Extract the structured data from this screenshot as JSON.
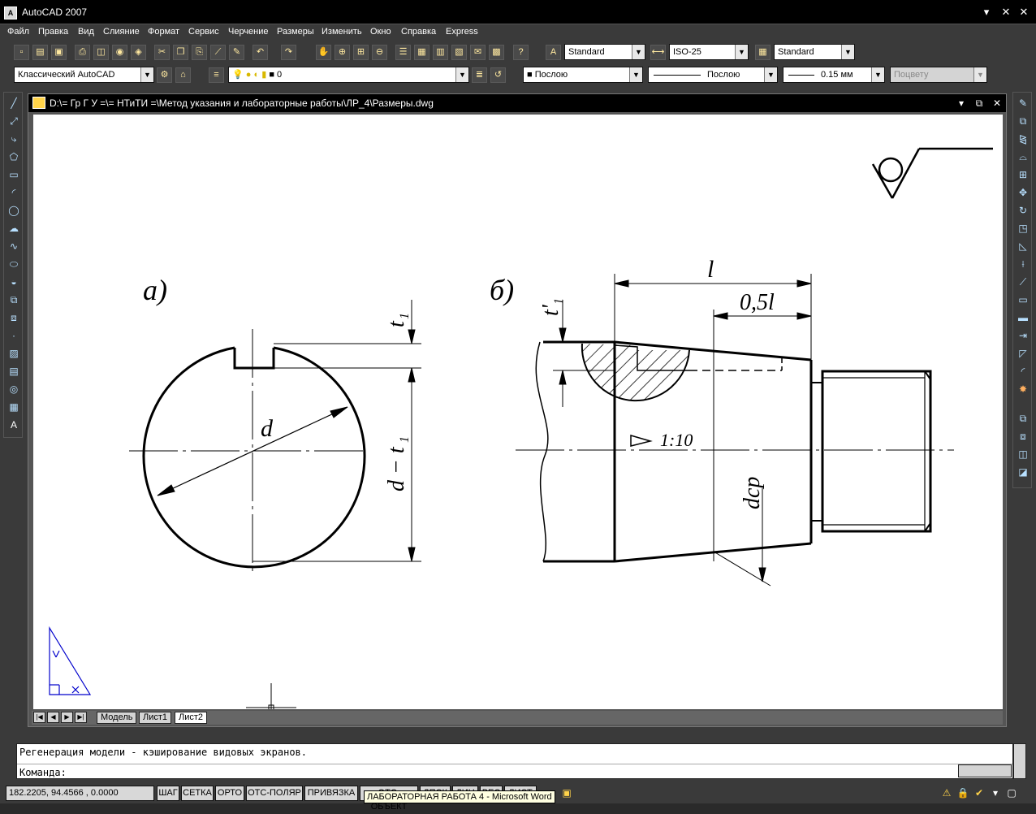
{
  "app": {
    "title": "AutoCAD 2007",
    "icon": "autocad-icon"
  },
  "window_controls": [
    "▾",
    "✕"
  ],
  "menu": [
    "Файл",
    "Правка",
    "Вид",
    "Слияние",
    "Формат",
    "Сервис",
    "Черчение",
    "Размеры",
    "Изменить",
    "Окно",
    "Справка",
    "Express"
  ],
  "toolbar1": {
    "text_style": "Standard",
    "dim_style": "ISO-25",
    "table_style": "Standard"
  },
  "toolbar2": {
    "workspace": "Классический AutoCAD",
    "layer": "0",
    "color": "Послою",
    "linetype": "Послою",
    "lineweight": "0.15 мм",
    "plotstyle": "Поцвету"
  },
  "document": {
    "title": "D:\\= Гр Г У =\\= НТиТИ =\\Метод указания и лабораторные работы\\ЛР_4\\Размеры.dwg"
  },
  "drawing_labels": {
    "a": "а)",
    "b": "б)",
    "d": "d",
    "t1": "t",
    "t1_sub": "1",
    "d_minus_t1": "d − t",
    "d_minus_t1_sub": "1",
    "t1_prime": "t'",
    "t1_prime_sub": "1",
    "l": "l",
    "half_l": "0,5l",
    "taper": "1:10",
    "dcp": "dср"
  },
  "tabs": [
    "Модель",
    "Лист1",
    "Лист2"
  ],
  "active_tab": "Лист2",
  "command": {
    "history": "Регенерация модели - кэширование видовых экранов.",
    "prompt": "Команда:"
  },
  "status": {
    "coords": "182.2205, 94.4566 , 0.0000",
    "buttons": [
      "ШАГ",
      "СЕТКА",
      "ОРТО",
      "ОТС-ПОЛЯР",
      "ПРИВЯЗКА",
      "ОТС-ОБЪЕКТ",
      "ДПСК",
      "ДИН",
      "ВЕС",
      "ЛИСТ"
    ],
    "tooltip": "ЛАБОРАТОРНАЯ РАБОТА 4 - Microsoft Word"
  }
}
